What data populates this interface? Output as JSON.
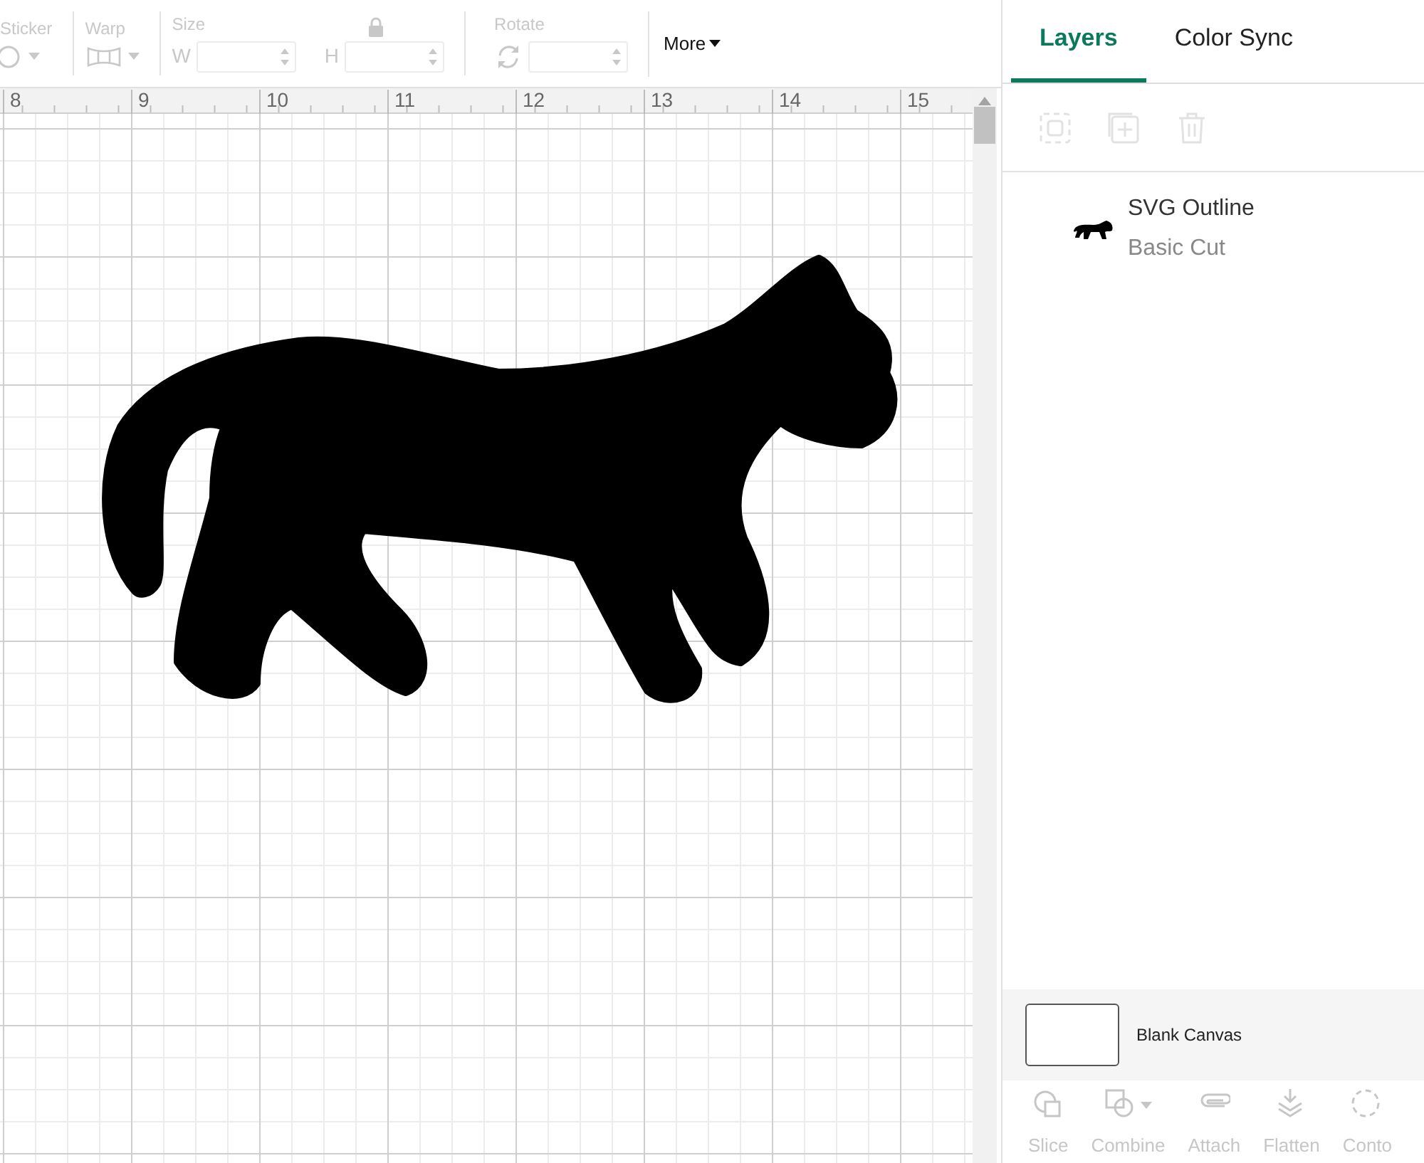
{
  "toolbar": {
    "sections": [
      {
        "kind": "dropdown_icon",
        "label": "Sticker",
        "disabled": true
      },
      {
        "kind": "dropdown_icon",
        "label": "Warp",
        "disabled": true
      },
      {
        "kind": "size",
        "label": "Size",
        "disabled": true,
        "width_label": "W",
        "height_label": "H"
      },
      {
        "kind": "rotate",
        "label": "Rotate",
        "disabled": true
      }
    ],
    "more_button": "More"
  },
  "ruler": {
    "labels": [
      "8",
      "9",
      "10",
      "11",
      "12",
      "13",
      "14",
      "15"
    ]
  },
  "panel": {
    "tabs": [
      {
        "label": "Layers",
        "selected": true
      },
      {
        "label": "Color Sync",
        "selected": false
      }
    ],
    "layer_actions": [
      {
        "kind": "group",
        "disabled": true
      },
      {
        "kind": "duplicate",
        "disabled": true
      },
      {
        "kind": "delete",
        "disabled": true
      }
    ],
    "layers": [
      {
        "name": "SVG Outline",
        "operation": "Basic Cut"
      }
    ],
    "canvas_item": {
      "label": "Blank Canvas"
    },
    "bottom_actions": [
      {
        "kind": "slice",
        "label": "Slice",
        "disabled": true
      },
      {
        "kind": "combine",
        "label": "Combine",
        "disabled": true
      },
      {
        "kind": "attach",
        "label": "Attach",
        "disabled": true
      },
      {
        "kind": "flatten",
        "label": "Flatten",
        "disabled": true
      },
      {
        "kind": "contour",
        "label": "Conto",
        "disabled": true
      }
    ]
  }
}
